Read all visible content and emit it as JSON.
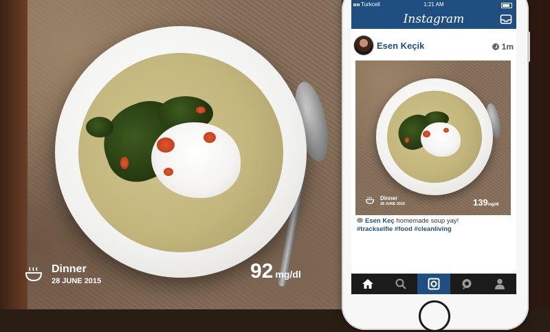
{
  "hero": {
    "meal": "Dinner",
    "date": "28 JUNE 2015",
    "reading_value": "92",
    "reading_unit": "mg/dl"
  },
  "statusbar": {
    "carrier": "Turkcell",
    "time": "1:21 AM"
  },
  "navbar": {
    "title": "Instagram"
  },
  "post": {
    "username": "Esen Keçik",
    "time": "1m",
    "photo": {
      "meal": "Dinner",
      "date": "28 JUNE 2015",
      "reading_value": "139",
      "reading_unit": "mg/dl"
    },
    "caption_author": "Esen Keç",
    "caption_text": " homemade soup yay!",
    "hashtags": "#trackselfie #food #cleanliving"
  },
  "tabbar": {
    "active_tab": "camera",
    "tabs": [
      "home-icon",
      "search-icon",
      "camera-icon",
      "activity-icon",
      "profile-icon"
    ]
  },
  "colors": {
    "brand_blue": "#1f4e80",
    "tabbar_bg": "#1b1b1b"
  }
}
